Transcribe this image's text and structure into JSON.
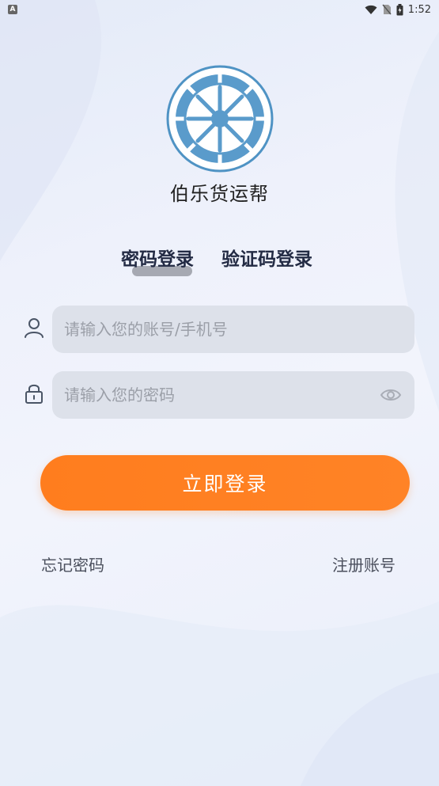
{
  "status_bar": {
    "app_icon_letter": "A",
    "time": "1:52",
    "icons": [
      "wifi-icon",
      "no-sim-icon",
      "battery-charging-icon"
    ]
  },
  "app": {
    "name": "伯乐货运帮",
    "logo_color": "#4f93c4"
  },
  "tabs": [
    {
      "label": "密码登录",
      "active": true
    },
    {
      "label": "验证码登录",
      "active": false
    }
  ],
  "form": {
    "account": {
      "placeholder": "请输入您的账号/手机号",
      "value": "",
      "icon": "user-icon"
    },
    "password": {
      "placeholder": "请输入您的密码",
      "value": "",
      "icon": "lock-icon",
      "toggle_icon": "eye-icon"
    }
  },
  "login_button": {
    "label": "立即登录",
    "color": "#ff7d1e"
  },
  "links": {
    "forgot": "忘记密码",
    "register": "注册账号"
  }
}
